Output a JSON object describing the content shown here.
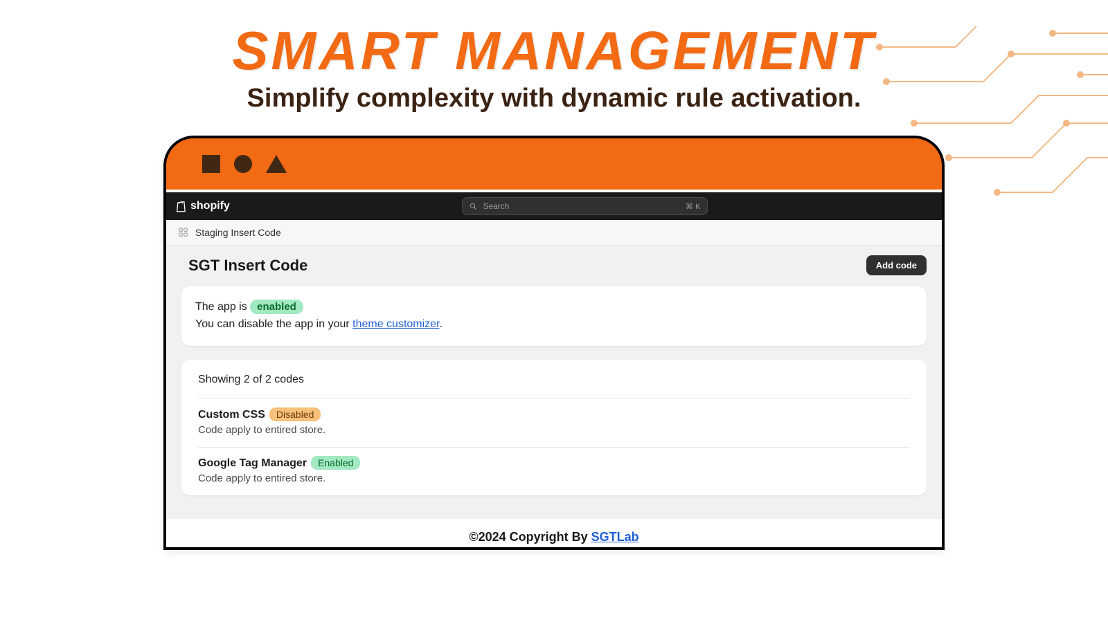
{
  "hero": {
    "title": "SMART MANAGEMENT",
    "subtitle": "Simplify complexity with dynamic rule activation."
  },
  "topbar": {
    "brand": "shopify",
    "search_placeholder": "Search",
    "search_shortcut": "⌘ K"
  },
  "breadcrumb": "Staging Insert Code",
  "page": {
    "title": "SGT Insert Code",
    "add_button": "Add code"
  },
  "status": {
    "prefix": "The app is ",
    "badge": "enabled",
    "line2a": "You can disable the app in your ",
    "link": "theme customizer",
    "line2b": "."
  },
  "codes": {
    "summary": "Showing 2 of 2 codes",
    "items": [
      {
        "name": "Custom CSS",
        "status": "Disabled",
        "status_kind": "disabled",
        "desc": "Code apply to entired store."
      },
      {
        "name": "Google Tag Manager",
        "status": "Enabled",
        "status_kind": "enabled",
        "desc": "Code apply to entired store."
      }
    ]
  },
  "footer": {
    "text": "©2024 Copyright By ",
    "link": "SGTLab"
  }
}
